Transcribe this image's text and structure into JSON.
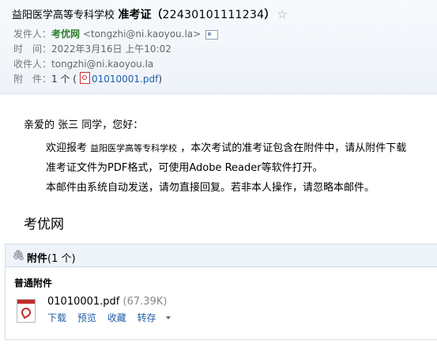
{
  "header": {
    "subject_school": "益阳医学高等专科学校",
    "subject_prefix": "准考证（",
    "subject_number": "22430101111234",
    "subject_suffix": "）",
    "sender_label": "发件人：",
    "sender_name": "考优网",
    "sender_email": "<tongzhi@ni.kaoyou.la>",
    "time_label": "时　间：",
    "time_value": "2022年3月16日 上午10:02",
    "recipient_label": "收件人：",
    "recipient_value": "tongzhi@ni.kaoyou.la",
    "attach_label": "附　件：",
    "attach_count": "1 个 (",
    "attach_file": "01010001.pdf",
    "attach_close": ")"
  },
  "body": {
    "greeting": "亲爱的 张三 同学，您好：",
    "para1_a": "欢迎报考",
    "para1_school": "益阳医学高等专科学校",
    "para1_b": "，本次考试的准考证包含在附件中，请从附件下载",
    "para2": "准考证文件为PDF格式，可使用Adobe Reader等软件打开。",
    "para3": "本邮件由系统自动发送，请勿直接回复。若非本人操作，请忽略本邮件。",
    "signature": "考优网"
  },
  "attachments": {
    "title": "附件",
    "count": "(1 个)",
    "section_label": "普通附件",
    "file_name": "01010001.pdf",
    "file_size": "(67.39K)",
    "actions": [
      "下载",
      "预览",
      "收藏",
      "转存"
    ]
  },
  "colors": {
    "link": "#1f5fa8",
    "sender": "#2a7d2a",
    "pdf": "#c62828"
  }
}
